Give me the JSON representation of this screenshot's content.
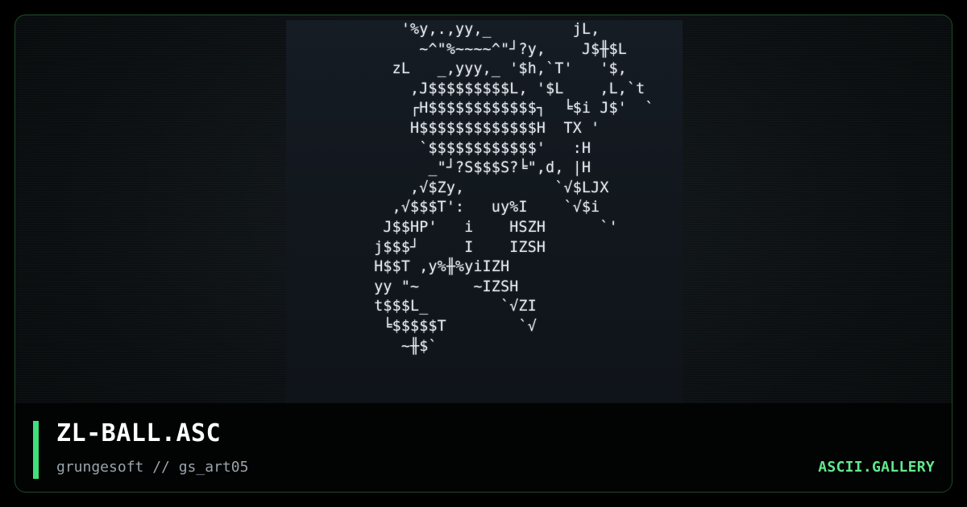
{
  "art": {
    "lines": [
      "    '%y,.,yy,_         jL,",
      "      ~^\"%~~~~^\"┘?y,    J$╫$L",
      "   zL   _,yyy,_ '$h,`T'   '$,",
      "     ,J$$$$$$$$$L, '$L    ,L,`t",
      "     ┌H$$$$$$$$$$$$┐  ╘$i J$'  `",
      "     H$$$$$$$$$$$$$H  TX '",
      "      `$$$$$$$$$$$$'   :H",
      "       _\"┘?S$$$S?╘\",d, |H",
      "     ,√$Zy,          `√$LJX",
      "   ,√$$$T':   uy%I    `√$i",
      "  J$$HP'   i    HSZH      `'",
      " j$$$┘     I    IZSH",
      " H$$T ,y%╫%yiIZH",
      " yy \"~      ~IZSH",
      " t$$$L_        `√ZI",
      "  ╘$$$$$T        `√",
      "    ~╫$`"
    ]
  },
  "footer": {
    "title": "ZL-BALL.ASC",
    "subtitle": "grungesoft // gs_art05",
    "brand": "ASCII.GALLERY"
  },
  "colors": {
    "accent": "#3fe07a",
    "brand": "#62e88d",
    "border": "#1f4a2a"
  }
}
